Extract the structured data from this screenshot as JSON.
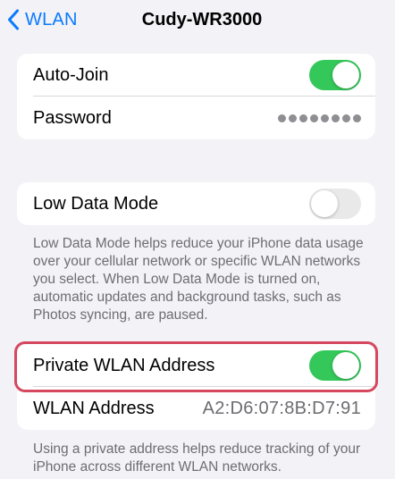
{
  "nav": {
    "back_label": "WLAN",
    "title": "Cudy-WR3000"
  },
  "group1": {
    "auto_join": {
      "label": "Auto-Join",
      "state": "on"
    },
    "password": {
      "label": "Password",
      "masked_dots": 8
    }
  },
  "group2": {
    "low_data_mode": {
      "label": "Low Data Mode",
      "state": "off"
    },
    "footnote": "Low Data Mode helps reduce your iPhone data usage over your cellular network or specific WLAN networks you select. When Low Data Mode is turned on, automatic updates and background tasks, such as Photos syncing, are paused."
  },
  "group3": {
    "private_address": {
      "label": "Private WLAN Address",
      "state": "on"
    },
    "wlan_address": {
      "label": "WLAN Address",
      "value": "A2:D6:07:8B:D7:91"
    },
    "footnote": "Using a private address helps reduce tracking of your iPhone across different WLAN networks."
  },
  "colors": {
    "accent": "#0a7aff",
    "toggle_on": "#34c759",
    "highlight_border": "#d5485f"
  },
  "icons": {
    "back": "chevron-left-icon"
  }
}
